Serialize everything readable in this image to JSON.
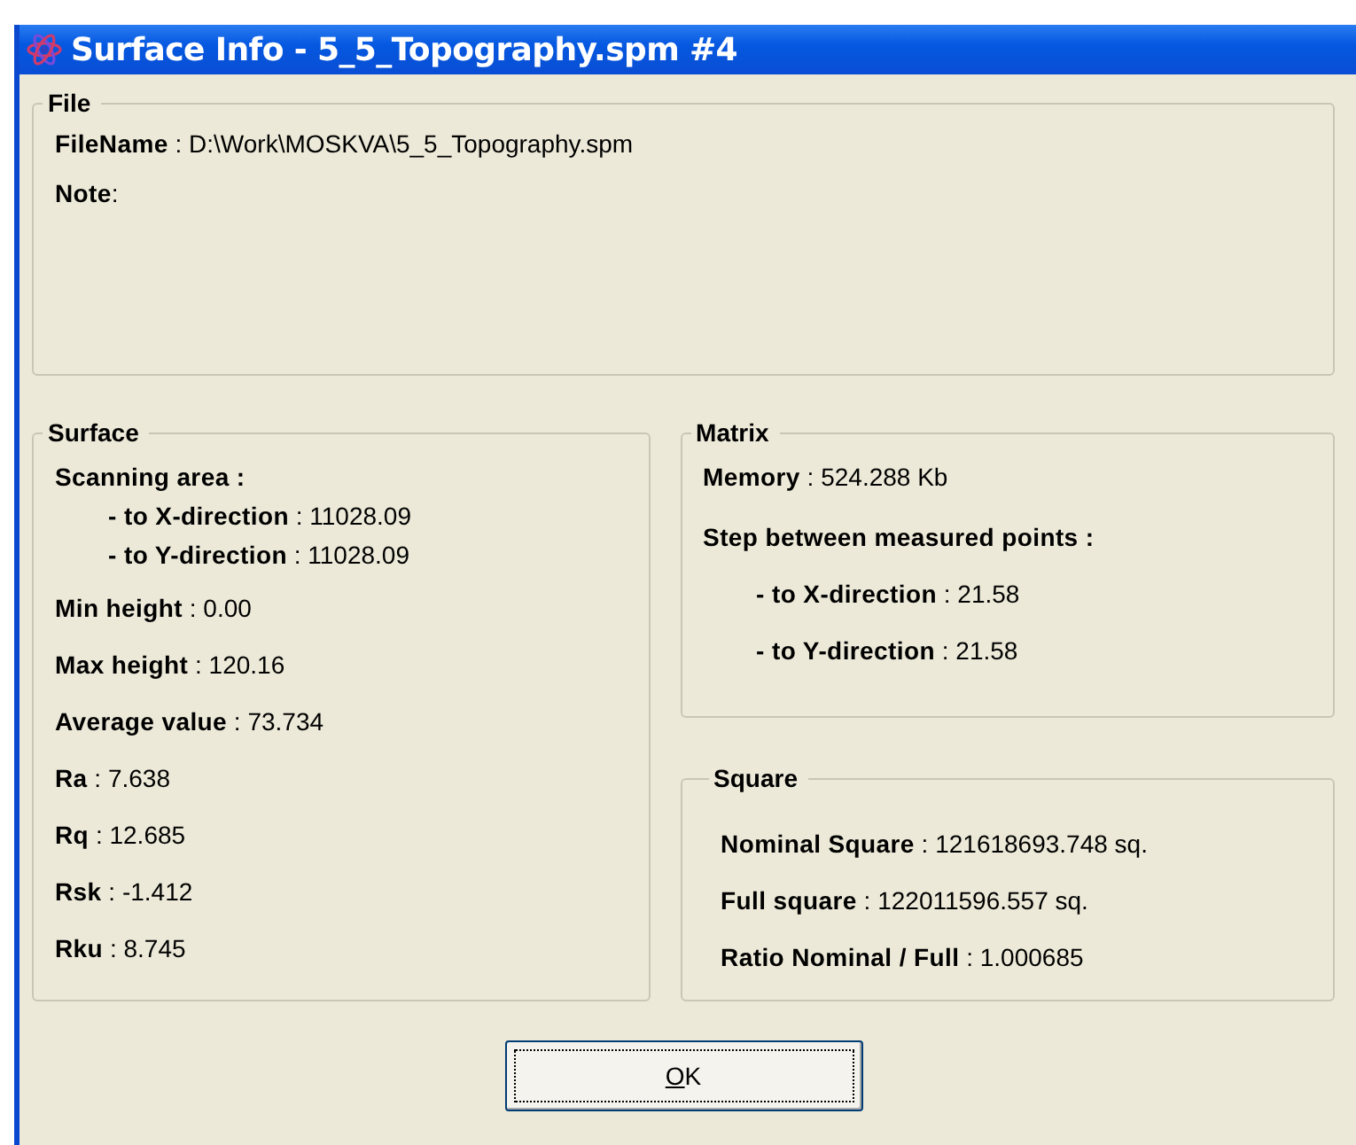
{
  "window": {
    "title": "Surface Info - 5_5_Topography.spm #4"
  },
  "file_group": {
    "title": "File",
    "rows": [
      {
        "kind": "item",
        "text": "**FileName** :  D:\\Work\\MOSKVA\\5_5_Topography.spm"
      },
      {
        "kind": "item",
        "text": "**Note**:"
      }
    ]
  },
  "surface_group": {
    "title": "Surface",
    "rows": [
      {
        "kind": "head",
        "text": "**Scanning area :**"
      },
      {
        "kind": "sub",
        "text": "**- to X-direction** :  11028.09"
      },
      {
        "kind": "sub",
        "text": "**- to Y-direction** :  11028.09"
      },
      {
        "kind": "item",
        "text": "**Min height** :  0.00"
      },
      {
        "kind": "item",
        "text": "**Max height** : 120.16"
      },
      {
        "kind": "item",
        "text": "**Average value** : 73.734"
      },
      {
        "kind": "item",
        "text": "**Ra** :  7.638"
      },
      {
        "kind": "item",
        "text": "**Rq** :  12.685"
      },
      {
        "kind": "item",
        "text": "**Rsk** :   -1.412"
      },
      {
        "kind": "item",
        "text": "**Rku** :   8.745"
      }
    ]
  },
  "matrix_group": {
    "title": "Matrix",
    "rows": [
      {
        "kind": "item",
        "text": "**Memory** : 524.288 Kb"
      },
      {
        "kind": "item",
        "text": "**Step between measured points :**"
      },
      {
        "kind": "sub",
        "text": "**- to X-direction** : 21.58"
      },
      {
        "kind": "sub",
        "text": "**- to Y-direction** : 21.58"
      }
    ]
  },
  "square_group": {
    "title": "Square",
    "rows": [
      {
        "kind": "item",
        "text": "**Nominal Square** :   121618693.748 sq."
      },
      {
        "kind": "item",
        "text": "**Full square** :   122011596.557 sq."
      },
      {
        "kind": "item",
        "text": "**Ratio Nominal / Full** :   1.000685"
      }
    ]
  },
  "buttons": [
    {
      "label": "OK"
    }
  ]
}
